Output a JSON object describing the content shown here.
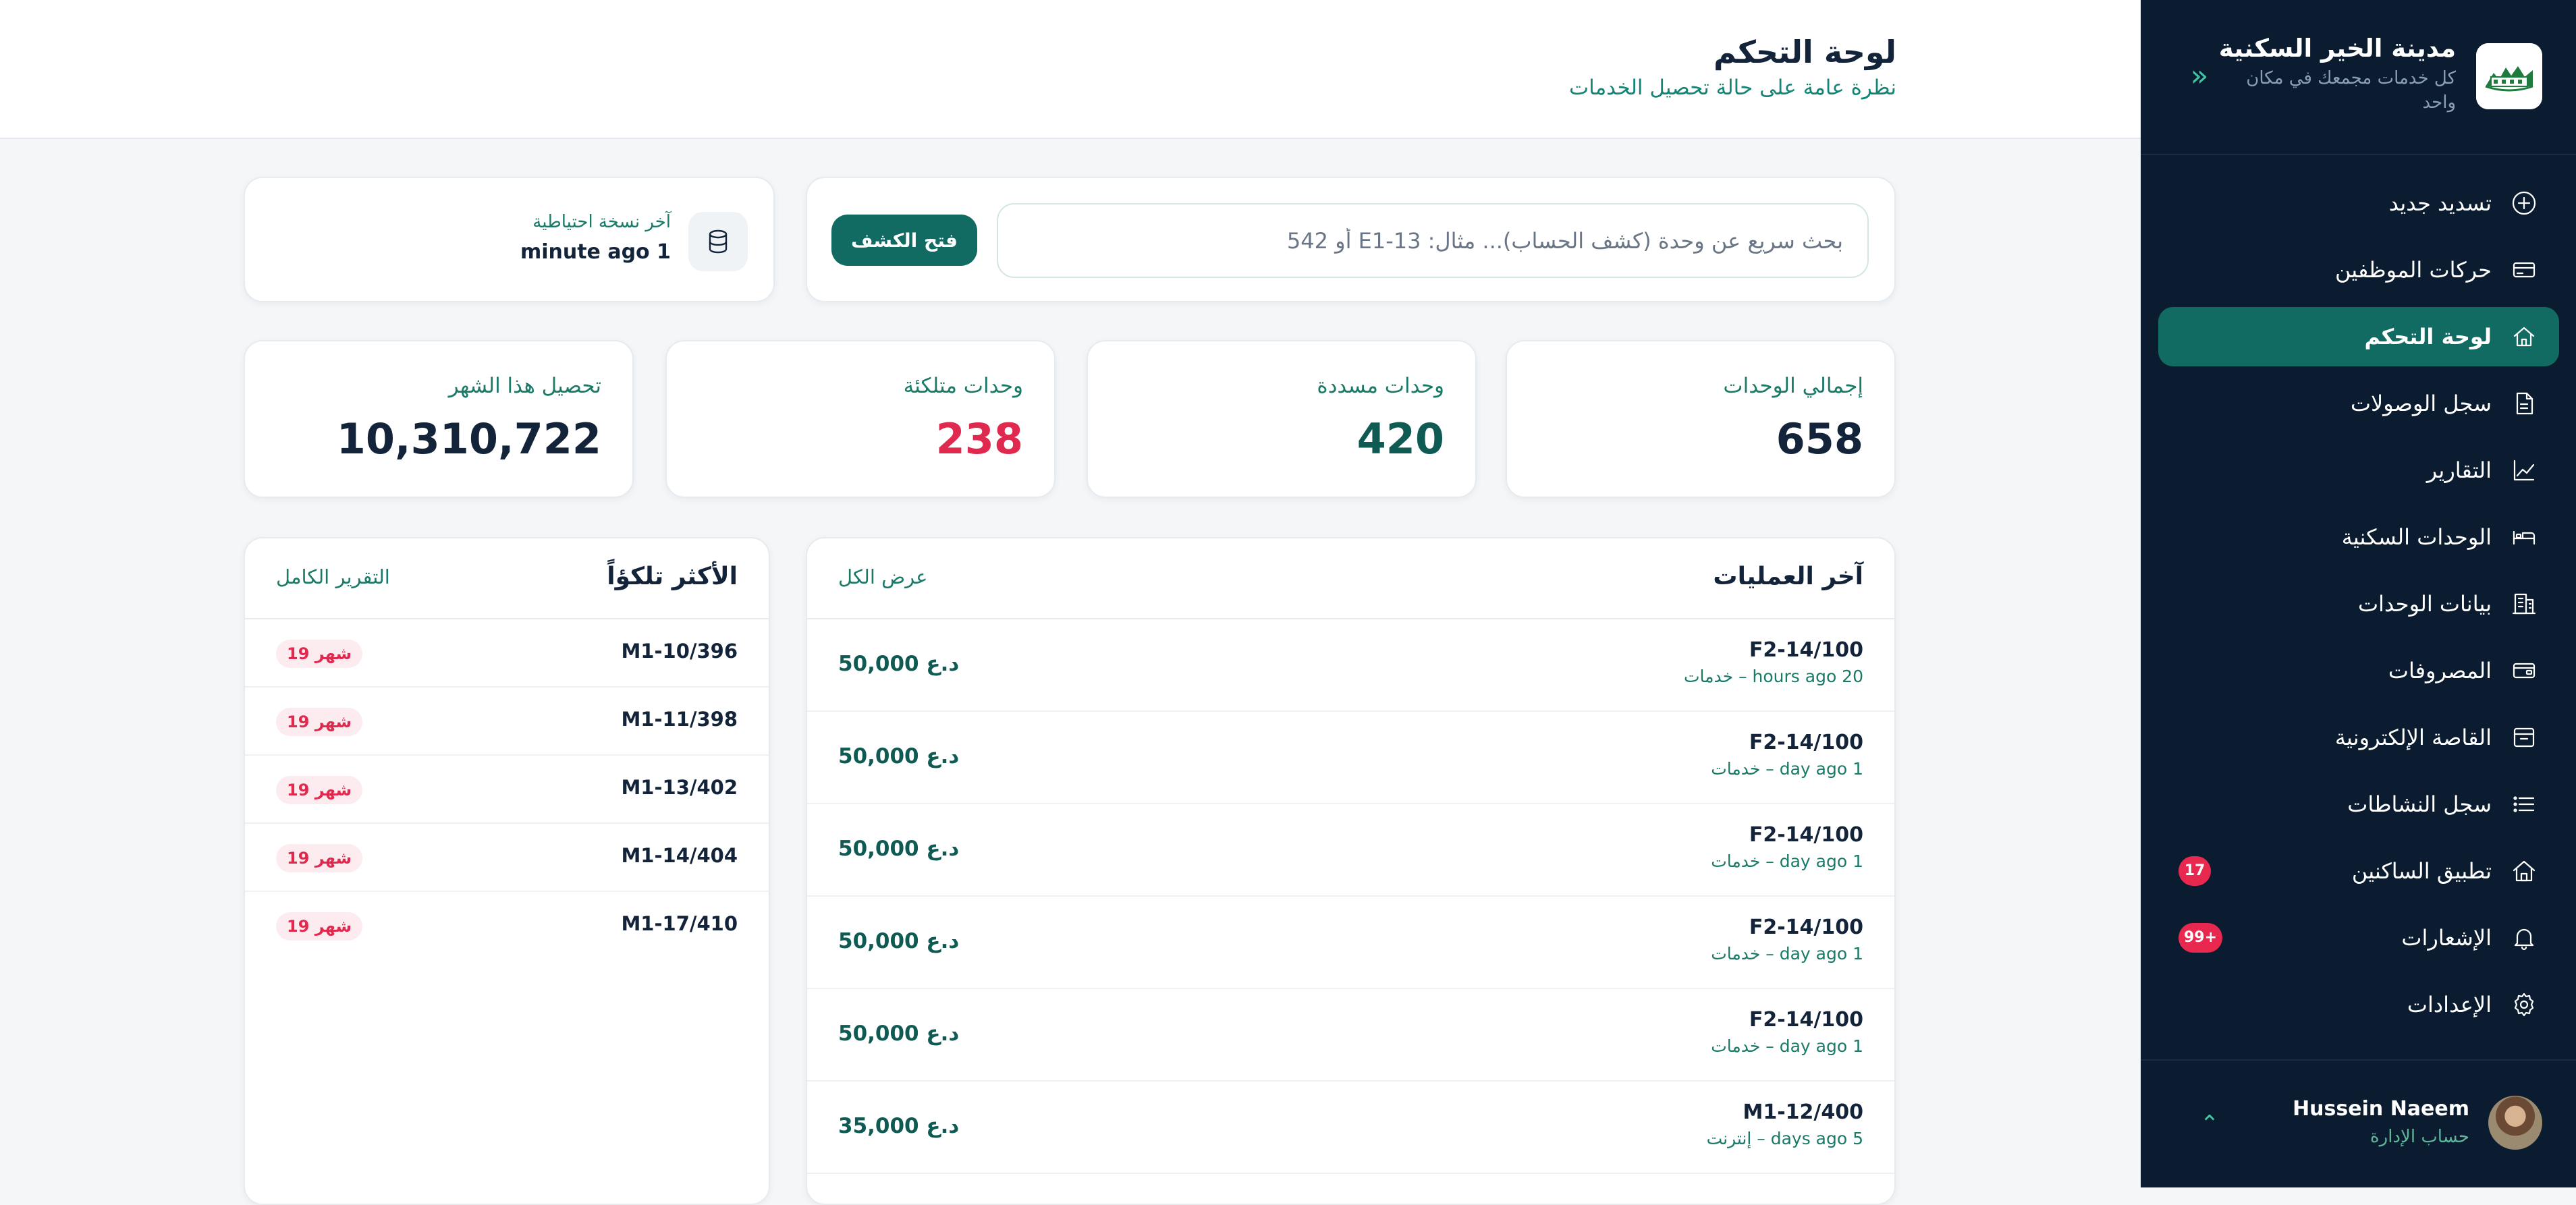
{
  "brand": {
    "title": "مدينة الخير السكنية",
    "subtitle": "كل خدمات مجمعك في مكان واحد"
  },
  "nav": {
    "items": [
      {
        "label": "تسديد جديد",
        "icon": "plus-circle-icon",
        "active": false,
        "badge": ""
      },
      {
        "label": "حركات الموظفين",
        "icon": "card-icon",
        "active": false,
        "badge": ""
      },
      {
        "label": "لوحة التحكم",
        "icon": "home-icon",
        "active": true,
        "badge": ""
      },
      {
        "label": "سجل الوصولات",
        "icon": "document-icon",
        "active": false,
        "badge": ""
      },
      {
        "label": "التقارير",
        "icon": "chart-line-icon",
        "active": false,
        "badge": ""
      },
      {
        "label": "الوحدات السكنية",
        "icon": "bed-icon",
        "active": false,
        "badge": ""
      },
      {
        "label": "بيانات الوحدات",
        "icon": "building-icon",
        "active": false,
        "badge": ""
      },
      {
        "label": "المصروفات",
        "icon": "wallet-icon",
        "active": false,
        "badge": ""
      },
      {
        "label": "القاصة الإلكترونية",
        "icon": "safe-icon",
        "active": false,
        "badge": ""
      },
      {
        "label": "سجل النشاطات",
        "icon": "list-icon",
        "active": false,
        "badge": ""
      },
      {
        "label": "تطبيق الساكنين",
        "icon": "house-icon",
        "active": false,
        "badge": "17"
      },
      {
        "label": "الإشعارات",
        "icon": "bell-icon",
        "active": false,
        "badge": "99+"
      },
      {
        "label": "الإعدادات",
        "icon": "gear-icon",
        "active": false,
        "badge": ""
      }
    ]
  },
  "profile": {
    "name": "Hussein Naeem",
    "role": "حساب الإدارة"
  },
  "header": {
    "title": "لوحة التحكم",
    "subtitle": "نظرة عامة على حالة تحصيل الخدمات"
  },
  "search": {
    "placeholder": "بحث سريع عن وحدة (كشف الحساب)... مثال: E1-13 أو 542",
    "button": "فتح الكشف"
  },
  "backup": {
    "label": "آخر نسخة احتياطية",
    "value": "minute ago 1"
  },
  "stats": [
    {
      "label": "إجمالي الوحدات",
      "value": "658",
      "color": "#13243a"
    },
    {
      "label": "وحدات مسددة",
      "value": "420",
      "color": "#0f5a52"
    },
    {
      "label": "وحدات متلكئة",
      "value": "238",
      "color": "#e0294f"
    },
    {
      "label": "تحصيل هذا الشهر",
      "value": "10,310,722",
      "color": "#13243a"
    }
  ],
  "operations": {
    "title": "آخر العمليات",
    "view_all": "عرض الكل",
    "rows": [
      {
        "unit": "F2-14/100",
        "meta": "خدمات – hours ago 20",
        "amount": "50,000 د.ع"
      },
      {
        "unit": "F2-14/100",
        "meta": "خدمات – day ago 1",
        "amount": "50,000 د.ع"
      },
      {
        "unit": "F2-14/100",
        "meta": "خدمات – day ago 1",
        "amount": "50,000 د.ع"
      },
      {
        "unit": "F2-14/100",
        "meta": "خدمات – day ago 1",
        "amount": "50,000 د.ع"
      },
      {
        "unit": "F2-14/100",
        "meta": "خدمات – day ago 1",
        "amount": "50,000 د.ع"
      },
      {
        "unit": "M1-12/400",
        "meta": "إنترنت – days ago 5",
        "amount": "35,000 د.ع"
      }
    ]
  },
  "top_delinquent": {
    "title": "الأكثر تلكؤاً",
    "full_report": "التقرير الكامل",
    "rows": [
      {
        "unit": "M1-10/396",
        "badge": "19 شهر"
      },
      {
        "unit": "M1-11/398",
        "badge": "19 شهر"
      },
      {
        "unit": "M1-13/402",
        "badge": "19 شهر"
      },
      {
        "unit": "M1-14/404",
        "badge": "19 شهر"
      },
      {
        "unit": "M1-17/410",
        "badge": "19 شهر"
      }
    ]
  },
  "colors": {
    "sidebar_bg": "#0b1c30",
    "accent": "#126b63",
    "danger": "#e0294f",
    "page_bg": "#f4f6f8"
  }
}
